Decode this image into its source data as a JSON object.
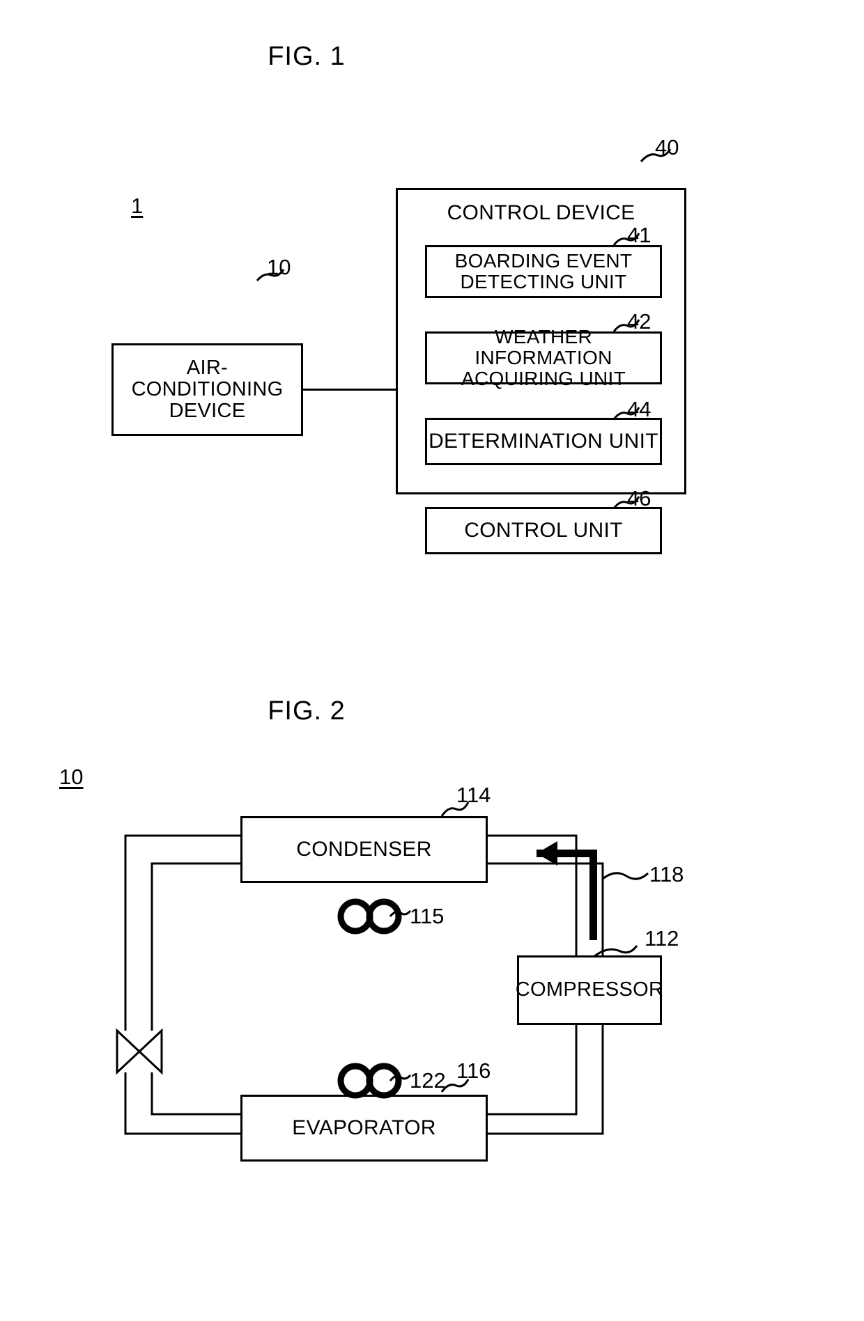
{
  "figures": [
    {
      "title": "FIG. 1",
      "system_label": "1",
      "blocks": {
        "air_conditioning_device": {
          "label": "AIR-CONDITIONING DEVICE",
          "ref": "10"
        },
        "control_device": {
          "label": "CONTROL DEVICE",
          "ref": "40"
        },
        "units": [
          {
            "label": "BOARDING EVENT DETECTING UNIT",
            "ref": "41"
          },
          {
            "label": "WEATHER INFORMATION ACQUIRING UNIT",
            "ref": "42"
          },
          {
            "label": "DETERMINATION UNIT",
            "ref": "44"
          },
          {
            "label": "CONTROL UNIT",
            "ref": "46"
          }
        ]
      }
    },
    {
      "title": "FIG. 2",
      "system_label": "10",
      "blocks": {
        "condenser": {
          "label": "CONDENSER",
          "ref": "114"
        },
        "compressor": {
          "label": "COMPRESSOR",
          "ref": "112"
        },
        "evaporator": {
          "label": "EVAPORATOR",
          "ref": "116"
        },
        "condenser_fan": {
          "ref": "115"
        },
        "evaporator_fan": {
          "ref": "122"
        },
        "flow_arrow": {
          "ref": "118"
        },
        "expansion_valve": {
          "ref": ""
        }
      }
    }
  ],
  "colors": {
    "ink": "#000000",
    "paper": "#ffffff"
  }
}
